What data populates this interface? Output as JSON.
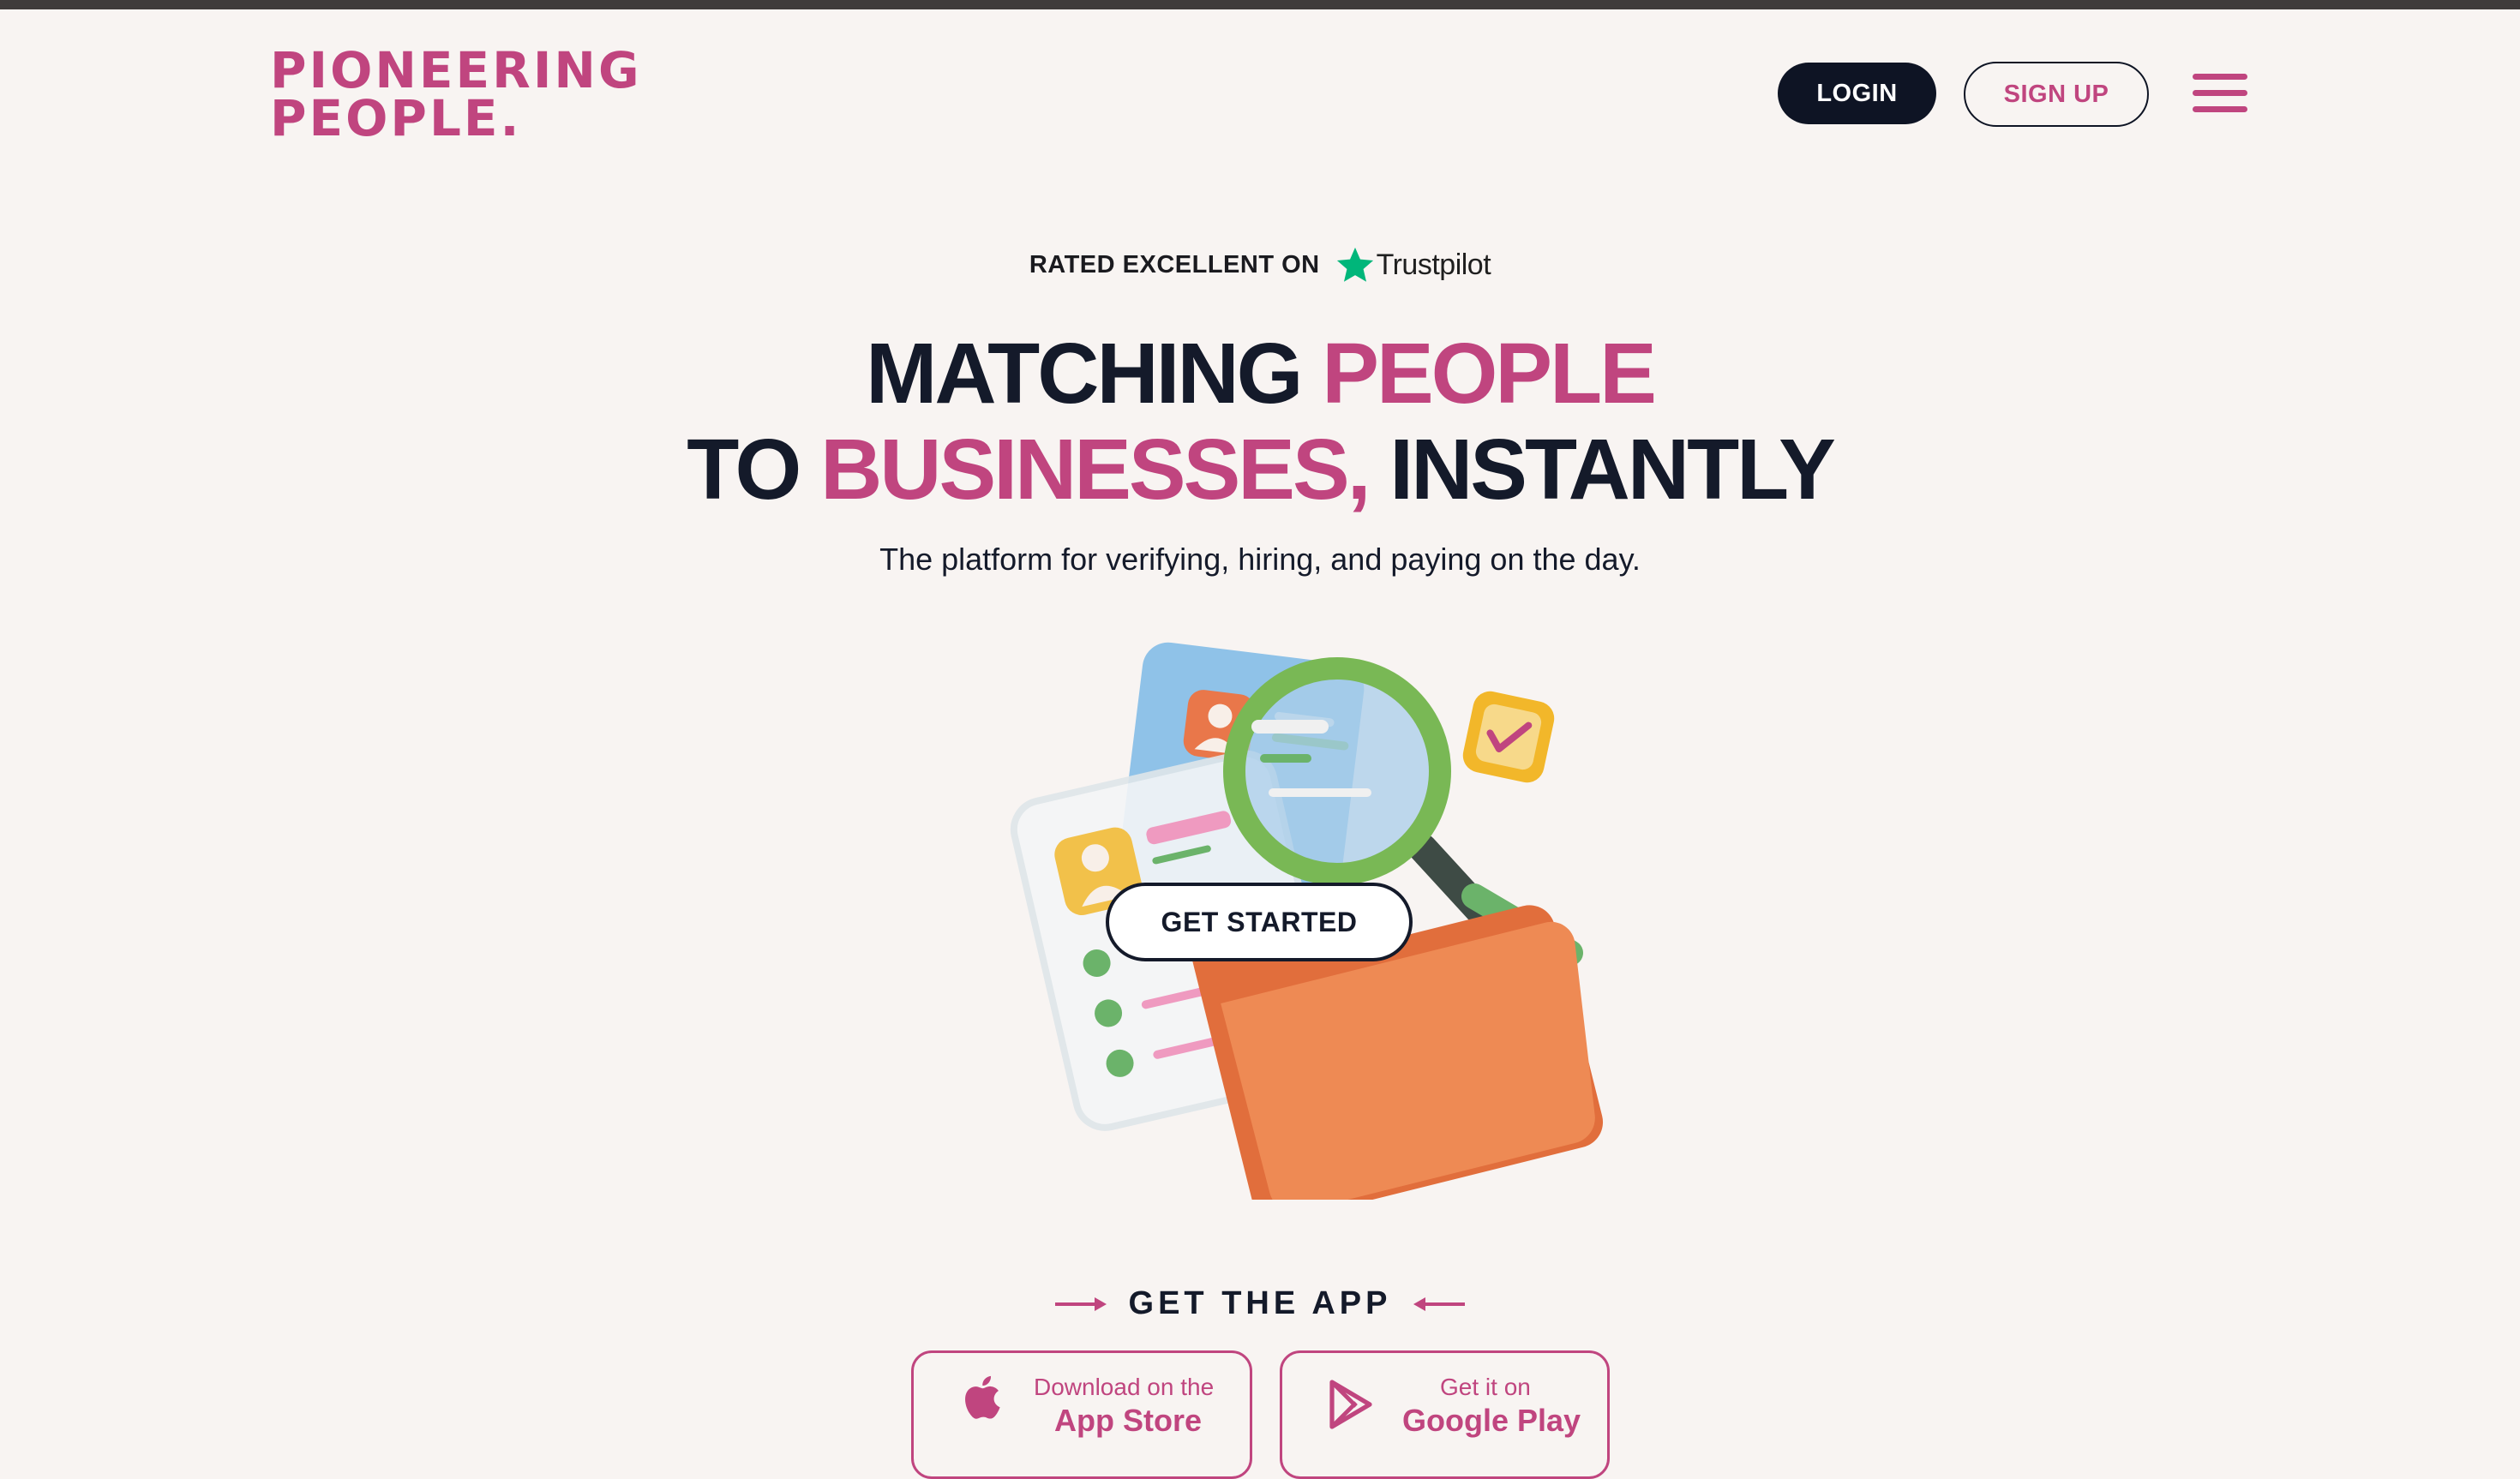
{
  "header": {
    "logo_line1": "PIONEERING",
    "logo_line2": "PEOPLE.",
    "login_label": "LOGIN",
    "signup_label": "SIGN UP"
  },
  "trust": {
    "rated_text": "RATED EXCELLENT ON",
    "brand": "Trustpilot"
  },
  "hero": {
    "line1_a": "MATCHING ",
    "line1_b": "PEOPLE",
    "line2_a": "TO ",
    "line2_b": "BUSINESSES,",
    "line2_c": " INSTANTLY",
    "subtitle": "The platform for verifying, hiring, and paying on the day.",
    "cta_label": "GET STARTED"
  },
  "app": {
    "section_label": "GET THE APP",
    "appstore_small": "Download on the",
    "appstore_big": "App Store",
    "googleplay_small": "Get it on",
    "googleplay_big": "Google Play"
  },
  "colors": {
    "brand_pink": "#c0457f",
    "navy": "#0e1424",
    "background": "#f8f4f2",
    "trustpilot_green": "#00b67a"
  }
}
